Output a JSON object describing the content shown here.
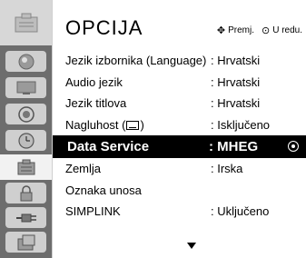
{
  "header": {
    "title": "OPCIJA",
    "hint_move": "Premj.",
    "hint_ok": "U redu."
  },
  "sidebar": {
    "items": [
      {
        "icon": "picture-icon"
      },
      {
        "icon": "screen-icon"
      },
      {
        "icon": "audio-icon"
      },
      {
        "icon": "time-icon"
      },
      {
        "icon": "option-icon",
        "active": true
      },
      {
        "icon": "lock-icon"
      },
      {
        "icon": "input-icon"
      },
      {
        "icon": "setup-icon"
      }
    ]
  },
  "menu": {
    "rows": [
      {
        "label": "Jezik izbornika (Language)",
        "value": ": Hrvatski"
      },
      {
        "label": "Audio jezik",
        "value": ": Hrvatski"
      },
      {
        "label": "Jezik titlova",
        "value": ": Hrvatski"
      },
      {
        "label_pre": "Nagluhost (",
        "label_post": ")",
        "value": ": Isključeno"
      },
      {
        "label": "Data Service",
        "value": ": MHEG",
        "selected": true
      },
      {
        "label": "Zemlja",
        "value": ": Irska"
      },
      {
        "label": "Oznaka unosa",
        "value": ""
      },
      {
        "label": "SIMPLINK",
        "value": ": Uključeno"
      }
    ]
  },
  "colors": {
    "sidebar_bg": "#6d6d6d",
    "selected_row_bg": "#000000",
    "selected_row_text": "#ffffff"
  }
}
